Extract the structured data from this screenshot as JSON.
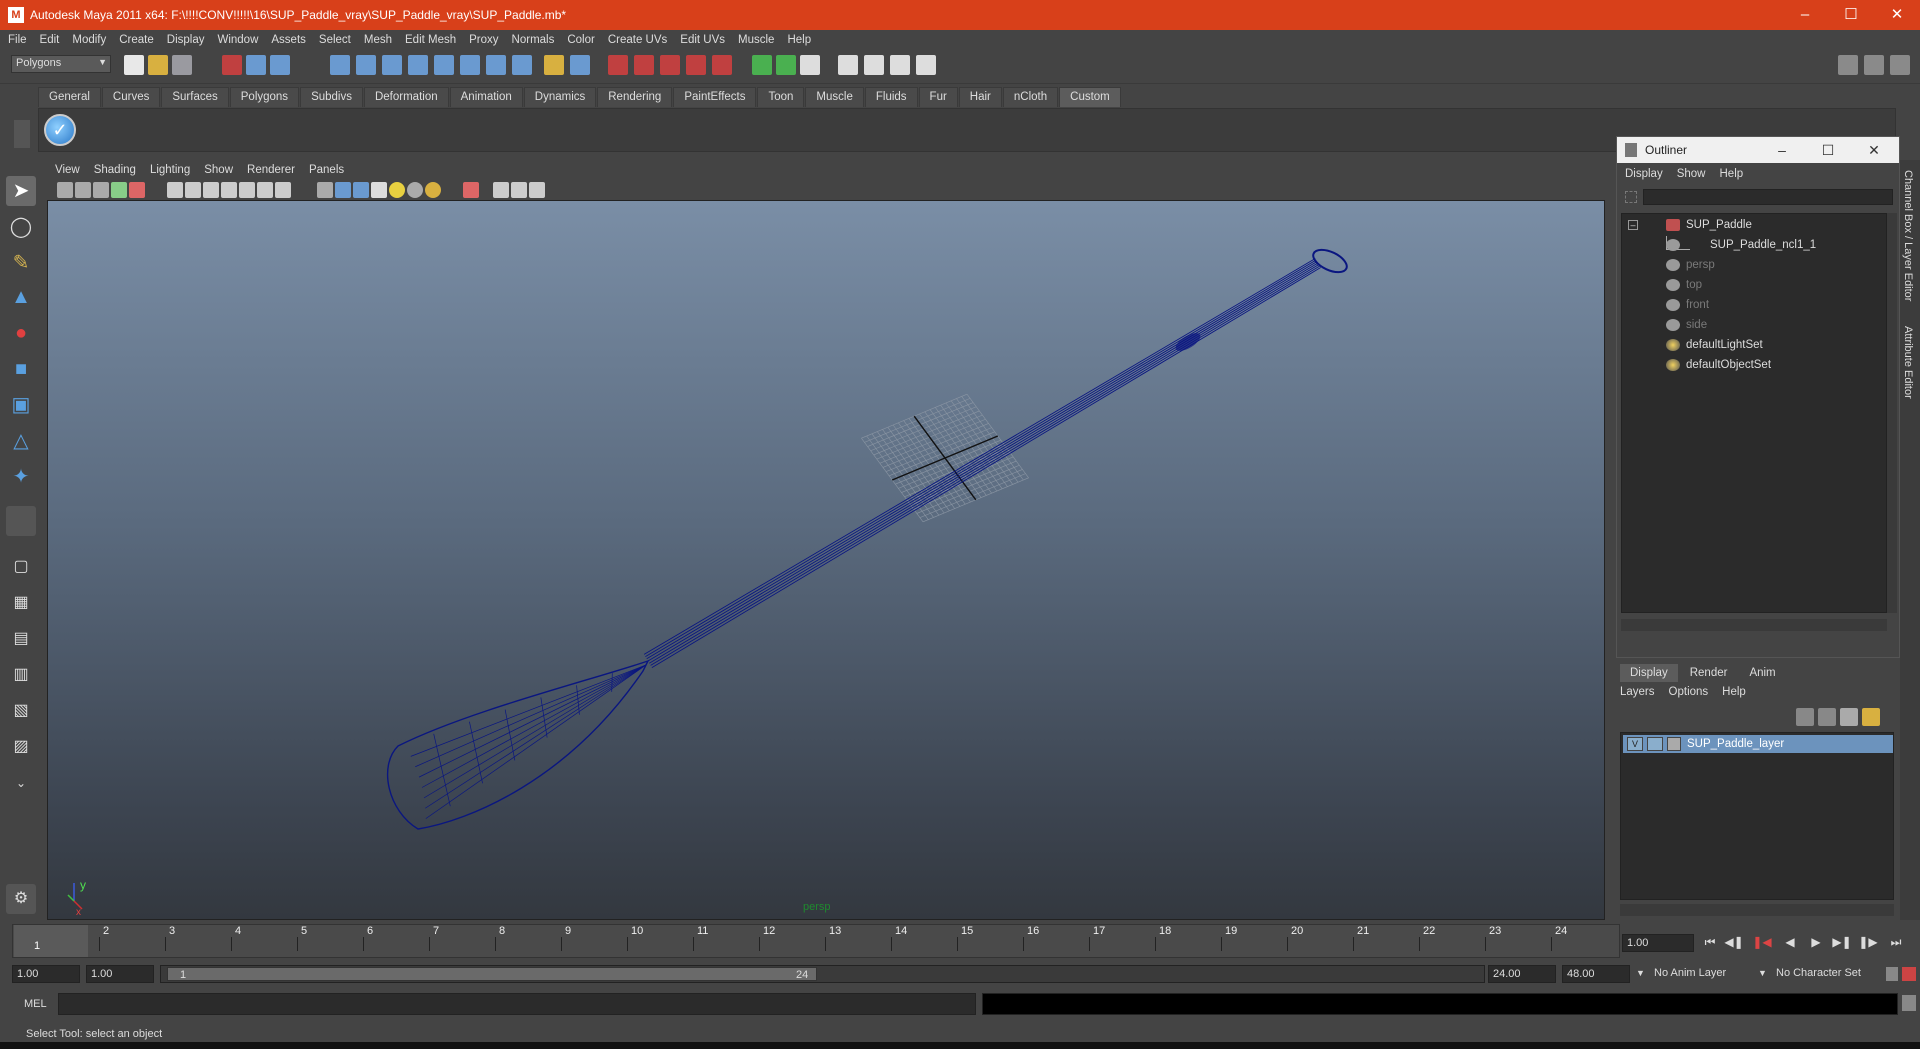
{
  "window": {
    "title": "Autodesk Maya 2011 x64: F:\\!!!!CONV!!!!!\\16\\SUP_Paddle_vray\\SUP_Paddle_vray\\SUP_Paddle.mb*",
    "app_icon_letter": "M"
  },
  "menubar": [
    "File",
    "Edit",
    "Modify",
    "Create",
    "Display",
    "Window",
    "Assets",
    "Select",
    "Mesh",
    "Edit Mesh",
    "Proxy",
    "Normals",
    "Color",
    "Create UVs",
    "Edit UVs",
    "Muscle",
    "Help"
  ],
  "mode_selector": "Polygons",
  "shelf": {
    "tabs": [
      "General",
      "Curves",
      "Surfaces",
      "Polygons",
      "Subdivs",
      "Deformation",
      "Animation",
      "Dynamics",
      "Rendering",
      "PaintEffects",
      "Toon",
      "Muscle",
      "Fluids",
      "Fur",
      "Hair",
      "nCloth",
      "Custom"
    ],
    "active_tab": "Custom"
  },
  "viewport": {
    "menu": [
      "View",
      "Shading",
      "Lighting",
      "Show",
      "Renderer",
      "Panels"
    ],
    "camera_label": "persp",
    "axis_y": "y",
    "axis_x": "x",
    "colors": {
      "wire": "#0a1680",
      "camera_label": "#1e8a2e"
    }
  },
  "outliner": {
    "title": "Outliner",
    "menu": [
      "Display",
      "Show",
      "Help"
    ],
    "items": [
      {
        "label": "SUP_Paddle",
        "dim": false
      },
      {
        "label": "SUP_Paddle_ncl1_1",
        "dim": false
      },
      {
        "label": "persp",
        "dim": true
      },
      {
        "label": "top",
        "dim": true
      },
      {
        "label": "front",
        "dim": true
      },
      {
        "label": "side",
        "dim": true
      },
      {
        "label": "defaultLightSet",
        "dim": false
      },
      {
        "label": "defaultObjectSet",
        "dim": false
      }
    ]
  },
  "layer_editor": {
    "tabs": [
      "Display",
      "Render",
      "Anim"
    ],
    "active_tab": "Display",
    "menu": [
      "Layers",
      "Options",
      "Help"
    ],
    "layers": [
      {
        "visible": "V",
        "name": "SUP_Paddle_layer"
      }
    ]
  },
  "side_tabs": [
    "Channel Box / Layer Editor",
    "Attribute Editor"
  ],
  "timeline": {
    "frames": [
      1,
      2,
      3,
      4,
      5,
      6,
      7,
      8,
      9,
      10,
      11,
      12,
      13,
      14,
      15,
      16,
      17,
      18,
      19,
      20,
      21,
      22,
      23,
      24
    ],
    "current_frame": "1",
    "time_field": "1.00"
  },
  "range": {
    "start_time": "1.00",
    "playback_start": "1.00",
    "range_start": "1",
    "range_end": "24",
    "playback_end": "24.00",
    "end_time": "48.00",
    "anim_layer": "No Anim Layer",
    "character_set": "No Character Set"
  },
  "command_line": {
    "label": "MEL"
  },
  "help_line": "Select Tool: select an object"
}
